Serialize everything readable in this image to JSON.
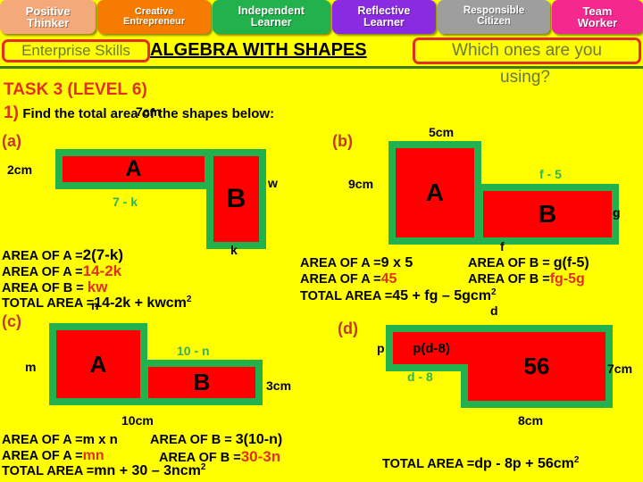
{
  "skills": {
    "tabs": [
      {
        "line1": "Positive",
        "line2": "Thinker",
        "color": "#f4a97a"
      },
      {
        "line1": "Creative",
        "line2": "Entrepreneur",
        "color": "#f57c00"
      },
      {
        "line1": "Independent",
        "line2": "Learner",
        "color": "#22b14c"
      },
      {
        "line1": "Reflective",
        "line2": "Learner",
        "color": "#8a2be2"
      },
      {
        "line1": "Responsible",
        "line2": "Citizen",
        "color": "#9e9e9e"
      },
      {
        "line1": "Team",
        "line2": "Worker",
        "color": "#f4288f"
      }
    ]
  },
  "header": {
    "enterprise_label": "Enterprise Skills",
    "title": "ALGEBRA WITH SHAPES",
    "question_line1": "Which ones are you",
    "question_line2": "using?"
  },
  "task": {
    "title": "TASK 3 (LEVEL 6)",
    "question_number": "1)",
    "question_text": "Find the total area of the shapes below:"
  },
  "parts": {
    "a": {
      "label": "(a)",
      "shape_a_letter": "A",
      "shape_b_letter": "B",
      "dims": {
        "top": "7cm",
        "left": "2cm",
        "bottom_a": "7 - k",
        "right": "w",
        "bottom_b": "k"
      },
      "formulas": {
        "line1_lhs": "AREA OF A =",
        "line1_rhs": "2(7-k)",
        "line2_lhs": "AREA OF A =",
        "line2_rhs": "14-2k",
        "line3_lhs": "AREA OF B = ",
        "line3_rhs": "kw",
        "line4_lhs": "TOTAL AREA =",
        "line4_rhs": "14-2k + kw",
        "line4_unit": "cm",
        "line4_sup": "2"
      }
    },
    "b": {
      "label": "(b)",
      "shape_a_letter": "A",
      "shape_b_letter": "B",
      "dims": {
        "top": "5cm",
        "left": "9cm",
        "top_b": "f - 5",
        "right": "g",
        "bottom": "f"
      },
      "formulas": {
        "a_line1_lhs": "AREA OF A =",
        "a_line1_rhs": "9 x 5",
        "a_line2_lhs": "AREA OF A =",
        "a_line2_rhs": "45",
        "b_line1_lhs": "AREA OF B = ",
        "b_line1_rhs": "g(f-5)",
        "b_line2_lhs": "AREA OF B =",
        "b_line2_rhs": "fg-5g",
        "total_lhs": "TOTAL AREA =",
        "total_rhs": "45 + fg – 5g",
        "total_unit": "cm",
        "total_sup": "2"
      }
    },
    "c": {
      "label": "(c)",
      "shape_a_letter": "A",
      "shape_b_letter": "B",
      "dims": {
        "top": "n",
        "left": "m",
        "top_b": "10 - n",
        "right": "3cm",
        "bottom": "10cm"
      },
      "formulas": {
        "a_line1_lhs": "AREA OF A =",
        "a_line1_rhs": "m x n",
        "a_line2_lhs": "AREA OF A =",
        "a_line2_rhs": "mn",
        "b_line1_lhs": "AREA OF B = ",
        "b_line1_rhs": "3(10-n)",
        "b_line2_lhs": "AREA OF B =",
        "b_line2_rhs": "30-3n",
        "total_lhs": "TOTAL AREA =",
        "total_rhs": "mn + 30 – 3n",
        "total_unit": "cm",
        "total_sup": "2"
      }
    },
    "d": {
      "label": "(d)",
      "shape_a_text": "p(d-8)",
      "shape_b_text": "56",
      "dims": {
        "top": "d",
        "left": "p",
        "bottom_a": "d - 8",
        "right": "7cm",
        "bottom_b": "8cm"
      },
      "formulas": {
        "total_lhs": "TOTAL AREA =",
        "total_rhs": "dp - 8p + 56",
        "total_unit": "cm",
        "total_sup": "2"
      }
    }
  }
}
